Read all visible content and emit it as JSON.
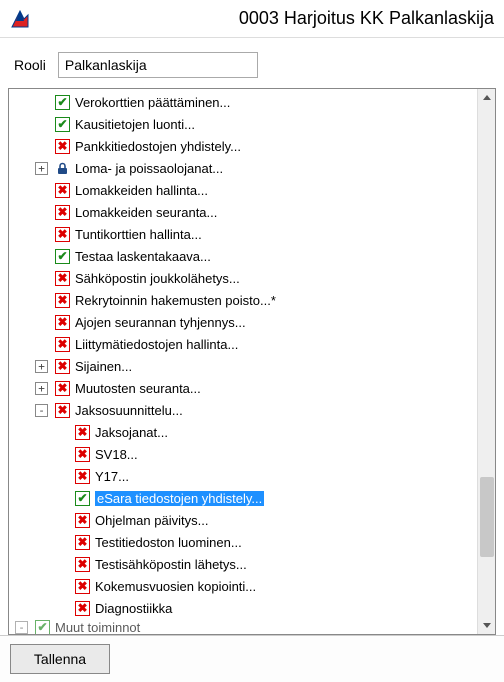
{
  "window": {
    "title": "0003 Harjoitus KK Palkanlaskija"
  },
  "role": {
    "label": "Rooli",
    "value": "Palkanlaskija"
  },
  "tree": {
    "items": [
      {
        "indent": 2,
        "expander": "",
        "check": "green",
        "label": "Verokorttien päättäminen...",
        "selected": false
      },
      {
        "indent": 2,
        "expander": "",
        "check": "green",
        "label": "Kausitietojen luonti...",
        "selected": false
      },
      {
        "indent": 2,
        "expander": "",
        "check": "red",
        "label": "Pankkitiedostojen yhdistely...",
        "selected": false
      },
      {
        "indent": 2,
        "expander": "+",
        "check": "lock",
        "label": "Loma- ja poissaolojanat...",
        "selected": false
      },
      {
        "indent": 2,
        "expander": "",
        "check": "red",
        "label": "Lomakkeiden hallinta...",
        "selected": false
      },
      {
        "indent": 2,
        "expander": "",
        "check": "red",
        "label": "Lomakkeiden seuranta...",
        "selected": false
      },
      {
        "indent": 2,
        "expander": "",
        "check": "red",
        "label": "Tuntikorttien hallinta...",
        "selected": false
      },
      {
        "indent": 2,
        "expander": "",
        "check": "green",
        "label": "Testaa laskentakaava...",
        "selected": false
      },
      {
        "indent": 2,
        "expander": "",
        "check": "red",
        "label": "Sähköpostin joukkolähetys...",
        "selected": false
      },
      {
        "indent": 2,
        "expander": "",
        "check": "red",
        "label": "Rekrytoinnin hakemusten poisto...*",
        "selected": false
      },
      {
        "indent": 2,
        "expander": "",
        "check": "red",
        "label": "Ajojen seurannan tyhjennys...",
        "selected": false
      },
      {
        "indent": 2,
        "expander": "",
        "check": "red",
        "label": "Liittymätiedostojen hallinta...",
        "selected": false
      },
      {
        "indent": 2,
        "expander": "+",
        "check": "red",
        "label": "Sijainen...",
        "selected": false
      },
      {
        "indent": 2,
        "expander": "+",
        "check": "red",
        "label": "Muutosten seuranta...",
        "selected": false
      },
      {
        "indent": 2,
        "expander": "-",
        "check": "red",
        "label": "Jaksosuunnittelu...",
        "selected": false
      },
      {
        "indent": 3,
        "expander": "",
        "check": "red",
        "label": "Jaksojanat...",
        "selected": false
      },
      {
        "indent": 3,
        "expander": "",
        "check": "red",
        "label": "SV18...",
        "selected": false
      },
      {
        "indent": 3,
        "expander": "",
        "check": "red",
        "label": "Y17...",
        "selected": false
      },
      {
        "indent": 3,
        "expander": "",
        "check": "green",
        "label": "eSara tiedostojen yhdistely...",
        "selected": true
      },
      {
        "indent": 3,
        "expander": "",
        "check": "red",
        "label": "Ohjelman päivitys...",
        "selected": false
      },
      {
        "indent": 3,
        "expander": "",
        "check": "red",
        "label": "Testitiedoston luominen...",
        "selected": false
      },
      {
        "indent": 3,
        "expander": "",
        "check": "red",
        "label": "Testisähköpostin lähetys...",
        "selected": false
      },
      {
        "indent": 3,
        "expander": "",
        "check": "red",
        "label": "Kokemusvuosien kopiointi...",
        "selected": false
      },
      {
        "indent": 3,
        "expander": "",
        "check": "red",
        "label": "Diagnostiikka",
        "selected": false
      },
      {
        "indent": 1,
        "expander": "-",
        "check": "green",
        "label": "Muut toiminnot",
        "selected": false,
        "cutoff": true
      }
    ]
  },
  "footer": {
    "save_label": "Tallenna"
  },
  "icons": {
    "check_green_glyph": "✔",
    "check_red_glyph": "✖"
  }
}
